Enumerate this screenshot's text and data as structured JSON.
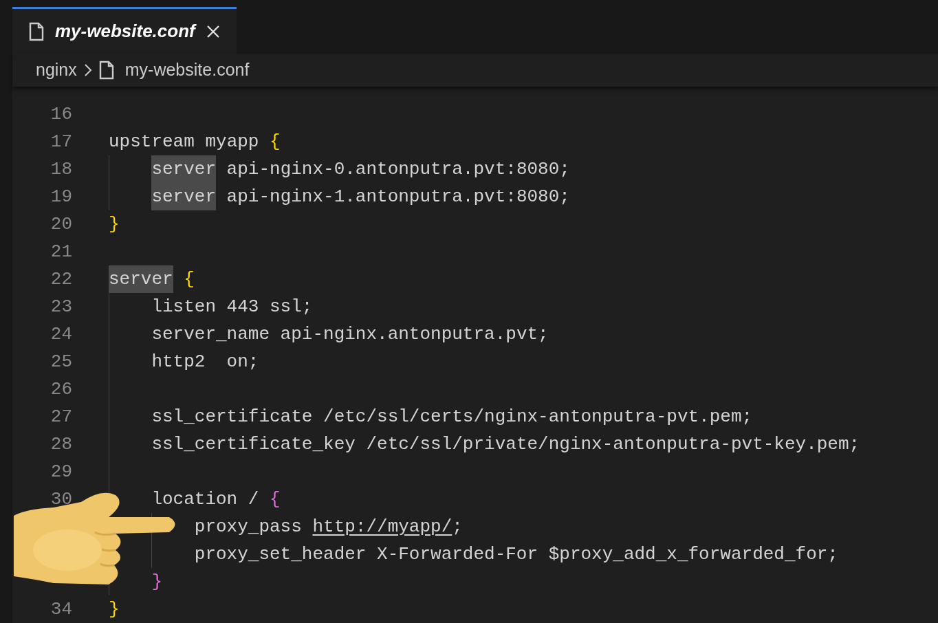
{
  "tab": {
    "title": "my-website.conf",
    "selected": true
  },
  "breadcrumb": [
    {
      "label": "nginx",
      "kind": "folder"
    },
    {
      "label": "my-website.conf",
      "kind": "file"
    }
  ],
  "lines": [
    {
      "number": "16"
    },
    {
      "number": "17",
      "tokens": [
        {
          "text": "upstream myapp ",
          "kind": "plain"
        },
        {
          "text": "{",
          "kind": "brace",
          "color": "#ffd700"
        }
      ],
      "children": [
        {
          "number": "18",
          "tokens": [
            {
              "text": "server",
              "kind": "highlight"
            },
            {
              "text": " api-nginx-0.antonputra.pvt:8080;",
              "kind": "plain"
            }
          ]
        },
        {
          "number": "19",
          "tokens": [
            {
              "text": "server",
              "kind": "highlight"
            },
            {
              "text": " api-nginx-1.antonputra.pvt:8080;",
              "kind": "plain"
            }
          ]
        }
      ]
    },
    {
      "number": "20",
      "tokens": [
        {
          "text": "}",
          "kind": "brace",
          "color": "#ffd700"
        }
      ]
    },
    {
      "number": "21"
    },
    {
      "number": "22",
      "tokens": [
        {
          "text": "server",
          "kind": "highlight"
        },
        {
          "text": "{",
          "kind": "brace",
          "color": "#ffd700"
        }
      ],
      "children": [
        {
          "number": "23",
          "tokens": [
            {
              "text": "listen 443 ssl;",
              "kind": "plain"
            }
          ]
        },
        {
          "number": "24",
          "tokens": [
            {
              "text": "server_name api-nginx.antonputra.pvt;",
              "kind": "plain"
            }
          ]
        },
        {
          "number": "25",
          "tokens": [
            {
              "text": "http2  on;",
              "kind": "plain"
            }
          ]
        },
        {
          "number": "26"
        },
        {
          "number": "27",
          "tokens": [
            {
              "text": "ssl_certificate /etc/ssl/certs/nginx-antonputra-pvt.pem;",
              "kind": "plain"
            }
          ]
        },
        {
          "number": "28",
          "tokens": [
            {
              "text": "ssl_certificate_key /etc/ssl/private/nginx-antonputra-pvt-key.pem;",
              "kind": "plain"
            }
          ]
        },
        {
          "number": "29"
        },
        {
          "number": "30",
          "tokens": [
            {
              "text": "location / ",
              "kind": "plain"
            },
            {
              "text": "{",
              "kind": "brace",
              "color": "#da70d6"
            }
          ],
          "children": [
            {
              "tokens": [
                {
                  "text": "proxy_pass ",
                  "kind": "plain"
                },
                {
                  "text": "http://myapp/",
                  "kind": "link"
                },
                {
                  "text": ";",
                  "kind": "plain"
                }
              ]
            },
            {
              "tokens": [
                {
                  "text": "proxy_set_header X-Forwarded-For $proxy_add_x_forwarded_for;",
                  "kind": "plain"
                }
              ]
            }
          ]
        },
        {
          "tokens": [
            {
              "text": "}",
              "kind": "brace",
              "color": "#da70d6"
            }
          ]
        }
      ]
    },
    {
      "number": "34",
      "tokens": [
        {
          "text": "}",
          "kind": "brace",
          "color": "#ffd700"
        }
      ]
    }
  ]
}
